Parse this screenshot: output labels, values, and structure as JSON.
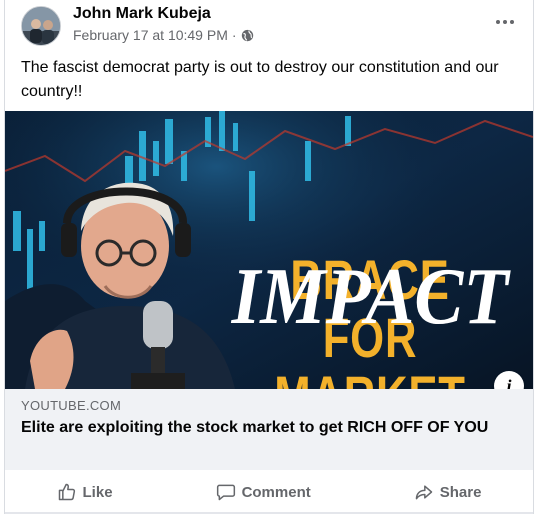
{
  "post": {
    "author": "John Mark Kubeja",
    "timestamp": "February 17 at 10:49 PM",
    "separator": "·",
    "privacy_icon": "globe-icon",
    "more_icon": "more-options-icon",
    "text": "The fascist democrat party is out to destroy our constitution and our country!!"
  },
  "link_preview": {
    "thumbnail": {
      "headline_line1": "BRACE",
      "headline_line2": "FOR MARKET",
      "headline_line3": "IMPACT",
      "info_label": "i"
    },
    "domain": "YOUTUBE.COM",
    "title": "Elite are exploiting the stock market to get RICH OFF OF YOU"
  },
  "actions": {
    "like": "Like",
    "comment": "Comment",
    "share": "Share"
  },
  "colors": {
    "headline_yellow": "#f3b12b",
    "text_primary": "#050505",
    "text_secondary": "#65676b",
    "link_box_bg": "#f0f2f5"
  }
}
